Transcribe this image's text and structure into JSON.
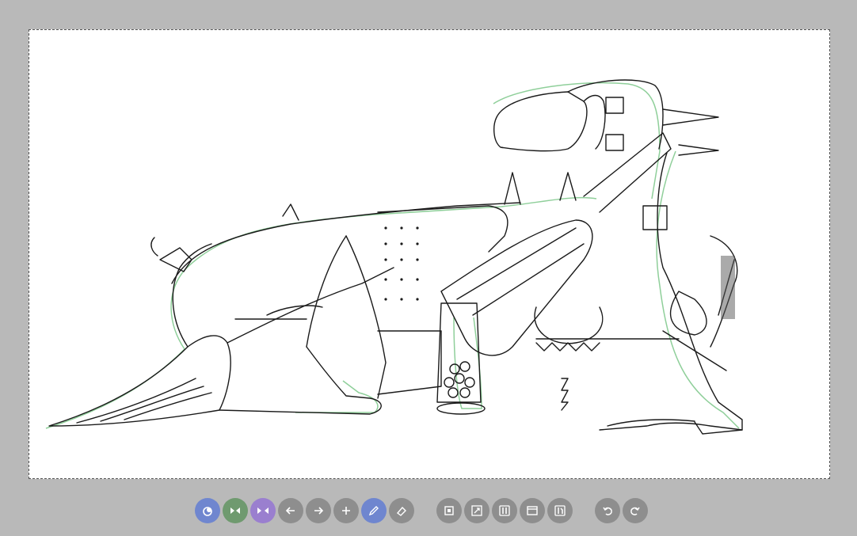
{
  "app": {
    "background": "#b9b9b9"
  },
  "canvas": {
    "paper": "#ffffff",
    "ink": "#1a1a1a",
    "shadow": "#8fcf9a"
  },
  "toolbar": {
    "groups": [
      [
        {
          "name": "onion-skin-button",
          "icon": "onion-icon",
          "color": "#6f86cf"
        },
        {
          "name": "prev-frame-toggle-button",
          "icon": "shrink-horizontal-icon",
          "color": "#6f9a6f"
        },
        {
          "name": "next-frame-toggle-button",
          "icon": "expand-horizontal-icon",
          "color": "#9a7fcf"
        },
        {
          "name": "previous-frame-button",
          "icon": "arrow-left-icon",
          "color": "#8e8e8e"
        },
        {
          "name": "next-frame-button",
          "icon": "arrow-right-icon",
          "color": "#8e8e8e"
        },
        {
          "name": "add-frame-button",
          "icon": "plus-icon",
          "color": "#8e8e8e"
        },
        {
          "name": "pen-tool-button",
          "icon": "pencil-icon",
          "color": "#6f86cf"
        },
        {
          "name": "eraser-tool-button",
          "icon": "eraser-icon",
          "color": "#8e8e8e"
        }
      ],
      [
        {
          "name": "fit-to-screen-button",
          "icon": "frame-square-icon",
          "color": "#8e8e8e"
        },
        {
          "name": "fullscreen-button",
          "icon": "expand-icon",
          "color": "#8e8e8e"
        },
        {
          "name": "brush-settings-button",
          "icon": "brush-settings-icon",
          "color": "#8e8e8e"
        },
        {
          "name": "window-button",
          "icon": "window-icon",
          "color": "#8e8e8e"
        },
        {
          "name": "tools-settings-button",
          "icon": "tools-icon",
          "color": "#8e8e8e"
        }
      ],
      [
        {
          "name": "undo-button",
          "icon": "undo-icon",
          "color": "#8e8e8e"
        },
        {
          "name": "redo-button",
          "icon": "redo-icon",
          "color": "#8e8e8e"
        }
      ]
    ]
  }
}
